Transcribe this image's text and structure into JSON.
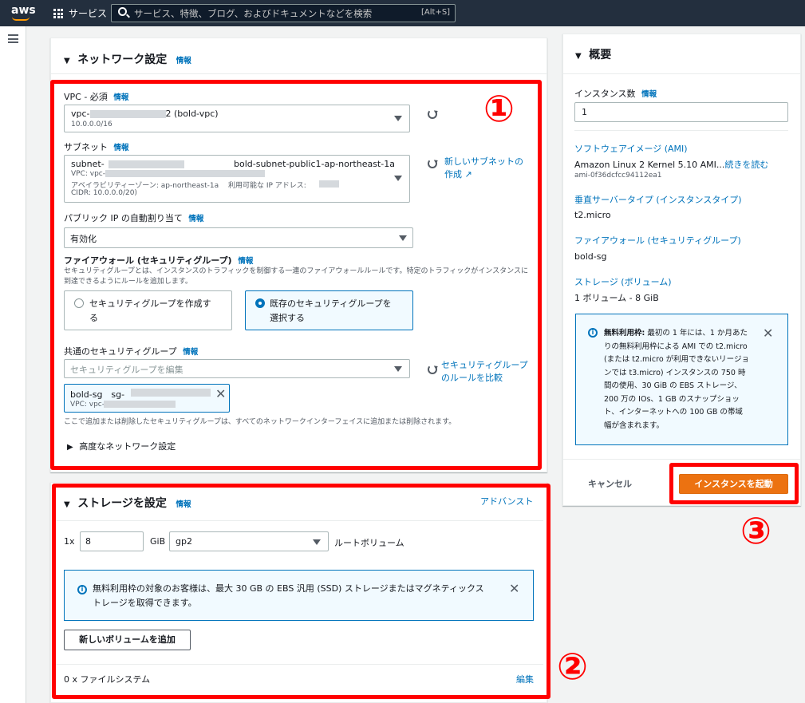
{
  "topbar": {
    "logo": "aws",
    "services_label": "サービス",
    "search_placeholder": "サービス、特徴、ブログ、およびドキュメントなどを検索",
    "search_shortcut": "[Alt+S]"
  },
  "network": {
    "title": "ネットワーク設定",
    "info": "情報",
    "vpc_label": "VPC - 必須",
    "vpc_value": "vpc-",
    "vpc_suffix": "2 (bold-vpc)",
    "vpc_cidr": "10.0.0.0/16",
    "subnet_label": "サブネット",
    "subnet_value": "subnet-",
    "subnet_name": "bold-subnet-public1-ap-northeast-1a",
    "subnet_vpc": "VPC: vpc-0",
    "subnet_az": "アベイラビリティーゾーン: ap-northeast-1a　 利用可能な IP アドレス:",
    "subnet_cidr": "CIDR: 10.0.0.0/20)",
    "new_subnet_link_line1": "新しいサブネットの",
    "new_subnet_link_line2": "作成",
    "public_ip_label": "パブリック IP の自動割り当て",
    "public_ip_value": "有効化",
    "firewall_label": "ファイアウォール (セキュリティグループ)",
    "firewall_desc": "セキュリティグループとは、インスタンスのトラフィックを制御する一連のファイアウォールルールです。特定のトラフィックがインスタンスに到達できるようにルールを追加します。",
    "radio_create_line1": "セキュリティグループを作成す",
    "radio_create_line2": "る",
    "radio_existing_line1": "既存のセキュリティグループを",
    "radio_existing_line2": "選択する",
    "common_sg_label": "共通のセキュリティグループ",
    "common_sg_placeholder": "セキュリティグループを編集",
    "compare_link_line1": "セキュリティグループ",
    "compare_link_line2": "のルールを比較",
    "sg_token_name": "bold-sg　sg-",
    "sg_token_vpc": "VPC: vpc-",
    "sg_note": "ここで追加または削除したセキュリティグループは、すべてのネットワークインターフェイスに追加または削除されます。",
    "advanced": "高度なネットワーク設定"
  },
  "storage": {
    "title": "ストレージを設定",
    "info": "情報",
    "advanced_link": "アドバンスト",
    "count": "1x",
    "size": "8",
    "unit": "GiB",
    "type": "gp2",
    "root": "ルートボリューム",
    "notice": "無料利用枠の対象のお客様は、最大 30 GB の EBS 汎用 (SSD) ストレージまたはマグネティックストレージを取得できます。",
    "add_volume": "新しいボリュームを追加",
    "fs": "0 x ファイルシステム",
    "edit": "編集"
  },
  "summary": {
    "title": "概要",
    "instances_label": "インスタンス数",
    "info": "情報",
    "instances_value": "1",
    "ami_label": "ソフトウェアイメージ (AMI)",
    "ami_value": "Amazon Linux 2 Kernel 5.10 AMI...",
    "ami_more": "続きを読む",
    "ami_id": "ami-0f36dcfcc94112ea1",
    "type_label": "垂直サーバータイプ (インスタンスタイプ)",
    "type_value": "t2.micro",
    "fw_label": "ファイアウォール (セキュリティグループ)",
    "fw_value": "bold-sg",
    "storage_label": "ストレージ (ボリューム)",
    "storage_value": "1 ボリューム - 8 GiB",
    "free_tier_title": "無料利用枠:",
    "free_tier_text": "最初の 1 年には、1 か月あたりの無料利用枠による AMI での t2.micro (または t2.micro が利用できないリージョンでは t3.micro) インスタンスの 750 時間の使用、30 GiB の EBS ストレージ、200 万の IOs、1 GB のスナップショット、インターネットへの 100 GB の帯域幅が含まれます。",
    "cancel": "キャンセル",
    "launch": "インスタンスを起動"
  },
  "annotations": {
    "one": "①",
    "two": "②",
    "three": "③"
  },
  "colors": {
    "highlight": "#ff0000",
    "primary": "#ec7211",
    "link": "#0073bb"
  }
}
